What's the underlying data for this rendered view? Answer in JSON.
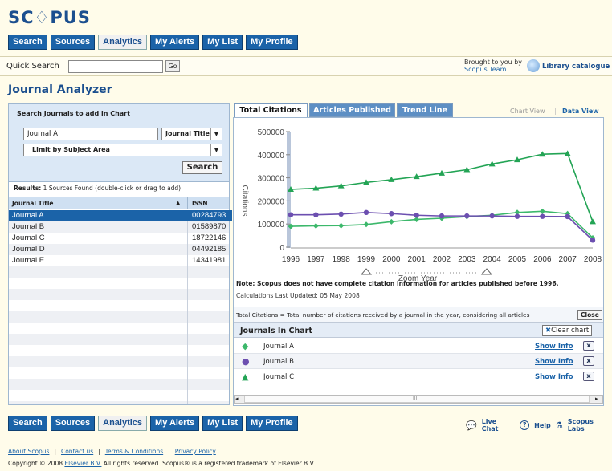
{
  "logo": "SC♢PUS",
  "nav": [
    "Search",
    "Sources",
    "Analytics",
    "My Alerts",
    "My List",
    "My Profile"
  ],
  "nav_active": "Analytics",
  "quick_search": {
    "label": "Quick Search",
    "value": "",
    "go": "Go"
  },
  "brought": {
    "line1": "Brought to you by",
    "line2": "Scopus Team",
    "catalogue": "Library catalogue"
  },
  "page_title": "Journal Analyzer",
  "search_panel": {
    "heading": "Search Journals to add in Chart",
    "query": "Journal A",
    "field": "Journal Title",
    "limit": "Limit by Subject Area",
    "search_btn": "Search",
    "results_bold": "Results:",
    "results_text": " 1 Sources Found (double-click or drag to add)",
    "col_title": "Journal Title",
    "col_issn": "ISSN",
    "rows": [
      {
        "title": "Journal A",
        "issn": "00284793"
      },
      {
        "title": "Journal B",
        "issn": "01589870"
      },
      {
        "title": "Journal C",
        "issn": "18722146"
      },
      {
        "title": "Journal D",
        "issn": "04492185"
      },
      {
        "title": "Journal E",
        "issn": "14341981"
      }
    ]
  },
  "tabs": [
    "Total Citations",
    "Articles Published",
    "Trend Line"
  ],
  "views": {
    "chart": "Chart View",
    "sep": "|",
    "data": "Data View"
  },
  "chart_data": {
    "type": "line",
    "x": [
      1996,
      1997,
      1998,
      1999,
      2000,
      2001,
      2002,
      2003,
      2004,
      2005,
      2006,
      2007,
      2008
    ],
    "ylabel": "Citations",
    "xlabel": "Zoom Year",
    "ylim": [
      0,
      500000
    ],
    "yticks": [
      "0",
      "100000",
      "200000",
      "300000",
      "400000",
      "500000"
    ],
    "series": [
      {
        "name": "Journal A",
        "color": "#3cb86b",
        "marker": "diamond",
        "values": [
          90000,
          92000,
          93000,
          98000,
          110000,
          120000,
          125000,
          132000,
          138000,
          150000,
          155000,
          145000,
          40000
        ]
      },
      {
        "name": "Journal B",
        "color": "#6c4fb0",
        "marker": "circle",
        "values": [
          140000,
          140000,
          143000,
          150000,
          145000,
          138000,
          135000,
          135000,
          135000,
          133000,
          133000,
          132000,
          30000
        ]
      },
      {
        "name": "Journal C",
        "color": "#23a455",
        "marker": "triangle",
        "values": [
          250000,
          255000,
          265000,
          280000,
          292000,
          305000,
          320000,
          335000,
          360000,
          378000,
          402000,
          405000,
          110000
        ]
      }
    ]
  },
  "note": "Note: Scopus does not have complete citation information for articles published before 1996.",
  "calc": "Calculations Last Updated: 05 May 2008",
  "definition": "Total Citations = Total number of citations received by a journal in the year, considering all articles",
  "close": "Close",
  "jic": {
    "heading": "Journals In Chart",
    "clear": "Clear chart",
    "show": "Show Info",
    "x": "x",
    "items": [
      {
        "name": "Journal A"
      },
      {
        "name": "Journal B"
      },
      {
        "name": "Journal C"
      }
    ]
  },
  "scroll_mid": "III",
  "footer_links": [
    "Live Chat",
    "Help",
    "Scopus Labs"
  ],
  "bottom_links": [
    "About Scopus",
    "Contact us",
    "Terms & Conditions",
    "Privacy Policy"
  ],
  "copyright_pre": "Copyright © 2008 ",
  "copyright_link": "Elsevier B.V.",
  "copyright_post": " All rights reserved. Scopus® is a registered trademark of Elsevier B.V."
}
